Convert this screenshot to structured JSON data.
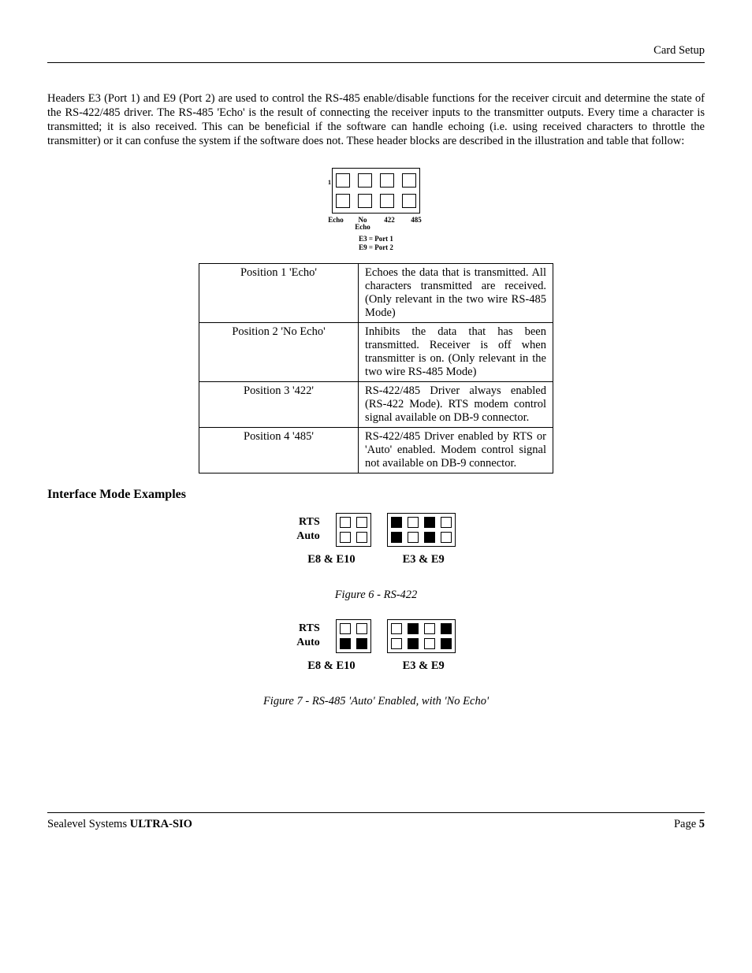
{
  "header": {
    "section": "Card Setup"
  },
  "intro": "Headers E3 (Port 1) and E9 (Port 2) are used to control the RS-485 enable/disable functions for the receiver circuit and determine the state of the RS-422/485 driver. The RS-485 'Echo' is the result of connecting the receiver inputs to the transmitter outputs. Every time a character is transmitted; it is also received. This can be beneficial if the software can handle echoing (i.e. using received characters to throttle the transmitter) or it can confuse the system if the software does not. These header blocks are described in the illustration and table that follow:",
  "jumper": {
    "col_labels": [
      "Echo",
      "No\nEcho",
      "422",
      "485"
    ],
    "sub1": "E3 = Port 1",
    "sub2": "E9 = Port 2"
  },
  "table": [
    {
      "pos": "Position 1 'Echo'",
      "desc": "Echoes the data that is transmitted. All characters transmitted are received.  (Only relevant in the two wire RS-485 Mode)"
    },
    {
      "pos": "Position 2 'No Echo'",
      "desc": "Inhibits the data that has been transmitted. Receiver is off when transmitter is on. (Only relevant in the two wire RS-485 Mode)"
    },
    {
      "pos": "Position 3 '422'",
      "desc": "RS-422/485 Driver always enabled (RS-422 Mode). RTS modem control signal available on DB-9 connector."
    },
    {
      "pos": "Position 4 '485'",
      "desc": "RS-422/485 Driver enabled by RTS or 'Auto' enabled. Modem control signal not available on DB-9 connector."
    }
  ],
  "section_heading": "Interface Mode Examples",
  "ex_labels": {
    "rts": "RTS",
    "auto": "Auto"
  },
  "ex_caps": {
    "left": "E8 & E10",
    "right": "E3 & E9"
  },
  "fig6": "Figure 6 - RS-422",
  "fig7": "Figure 7 - RS-485 'Auto' Enabled, with 'No Echo'",
  "footer": {
    "company": "Sealevel Systems ",
    "product": "ULTRA-SIO",
    "page_label": "Page ",
    "page_num": "5"
  }
}
